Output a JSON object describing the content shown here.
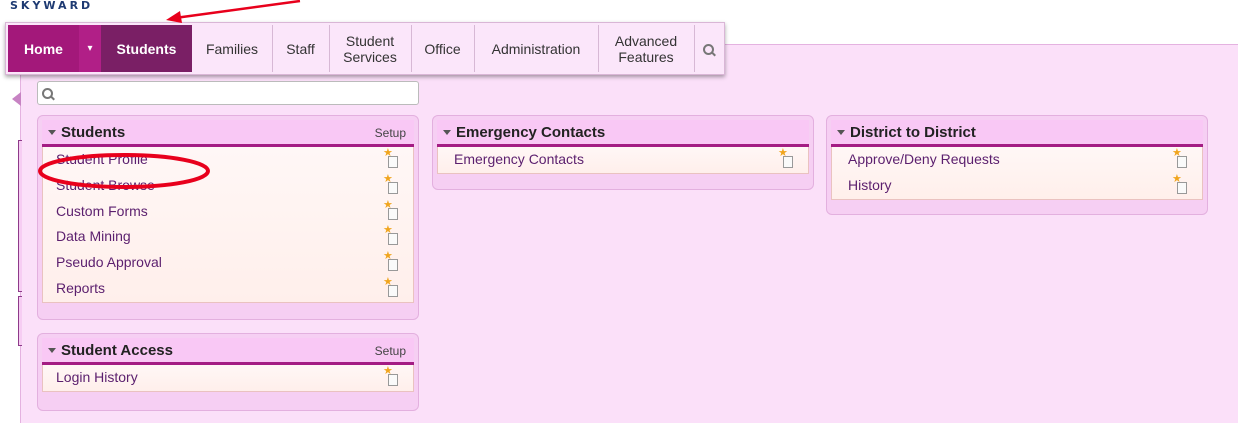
{
  "logo": "SKYWARD",
  "nav": {
    "home": "Home",
    "caret": "▾",
    "items": [
      "Students",
      "Families",
      "Staff",
      "Student Services",
      "Office",
      "Administration",
      "Advanced Features"
    ],
    "search_icon": "search-icon"
  },
  "search": {
    "placeholder": "",
    "value": ""
  },
  "widgets": {
    "students": {
      "title": "Students",
      "setup": "Setup",
      "links": [
        "Student Profile",
        "Student Browse",
        "Custom Forms",
        "Data Mining",
        "Pseudo Approval",
        "Reports"
      ]
    },
    "student_access": {
      "title": "Student Access",
      "setup": "Setup",
      "links": [
        "Login History"
      ]
    },
    "emergency_contacts": {
      "title": "Emergency Contacts",
      "links": [
        "Emergency Contacts"
      ]
    },
    "district_to_district": {
      "title": "District to District",
      "links": [
        "Approve/Deny Requests",
        "History"
      ]
    }
  },
  "colors": {
    "accent": "#a41c84",
    "nav_selected": "#7a1f65",
    "panel_bg": "#fbe0f9",
    "annotation_red": "#e8001c"
  },
  "icons": {
    "favorite": "favorite-star-icon",
    "collapse": "collapse-triangle-icon"
  }
}
